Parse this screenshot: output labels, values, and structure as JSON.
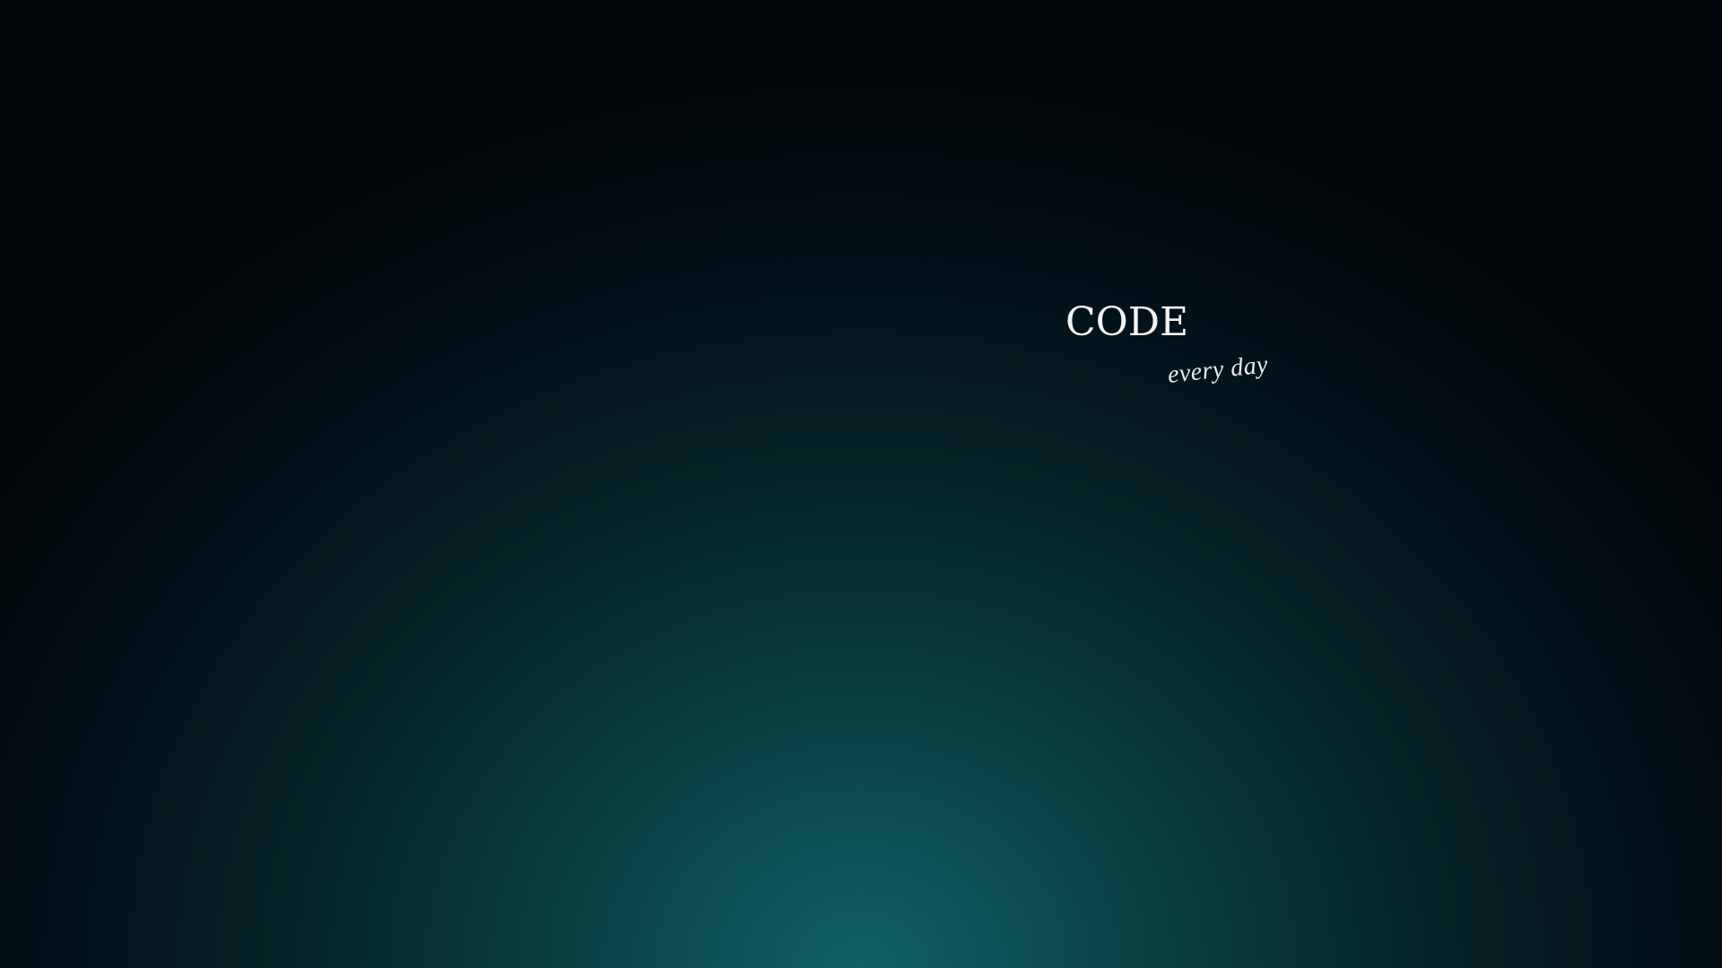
{
  "wallpaper": {
    "title": "CODE",
    "tagline": "every day",
    "colors": {
      "glow": "#0f6166",
      "background": "#020608",
      "text": "#f4f4f2"
    }
  }
}
